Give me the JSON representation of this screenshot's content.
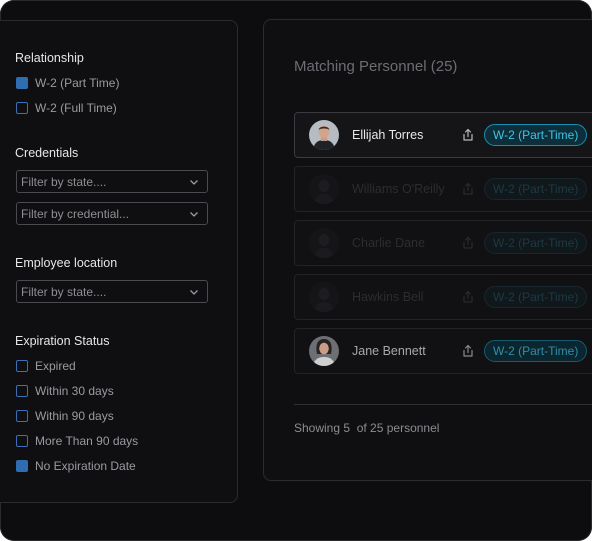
{
  "filters": {
    "relationship": {
      "title": "Relationship",
      "options": [
        {
          "label": "W-2 (Part Time)",
          "checked": true
        },
        {
          "label": "W-2 (Full Time)",
          "checked": false
        }
      ]
    },
    "credentials": {
      "title": "Credentials",
      "state_placeholder": "Filter by state....",
      "credential_placeholder": "Filter by credential..."
    },
    "location": {
      "title": "Employee location",
      "state_placeholder": "Filter by state...."
    },
    "expiration": {
      "title": "Expiration Status",
      "options": [
        {
          "label": "Expired",
          "checked": false
        },
        {
          "label": "Within 30 days",
          "checked": false
        },
        {
          "label": "Within 90 days",
          "checked": false
        },
        {
          "label": "More Than 90 days",
          "checked": false
        },
        {
          "label": "No Expiration Date",
          "checked": true
        }
      ]
    }
  },
  "results": {
    "title": "Matching Personnel (25)",
    "personnel": [
      {
        "name": "Ellijah Torres",
        "tag": "W-2 (Part-Time)",
        "icon": "share-icon"
      },
      {
        "name": "Williams O'Reilly",
        "tag": "W-2 (Part-Time)",
        "icon": "share-icon"
      },
      {
        "name": "Charlie Dane",
        "tag": "W-2 (Part-Time)",
        "icon": "share-icon"
      },
      {
        "name": "Hawkins Bell",
        "tag": "W-2 (Part-Time)",
        "icon": "share-icon"
      },
      {
        "name": "Jane Bennett",
        "tag": "W-2 (Part-Time)",
        "icon": "share-icon"
      }
    ],
    "footer": "Showing 5  of 25 personnel"
  },
  "colors": {
    "background": "#0d0d0f",
    "panel": "#0f0f11",
    "accent_checkbox": "#2f6db3",
    "tag_text": "#43c2e0",
    "tag_border": "#1a8fb0"
  }
}
